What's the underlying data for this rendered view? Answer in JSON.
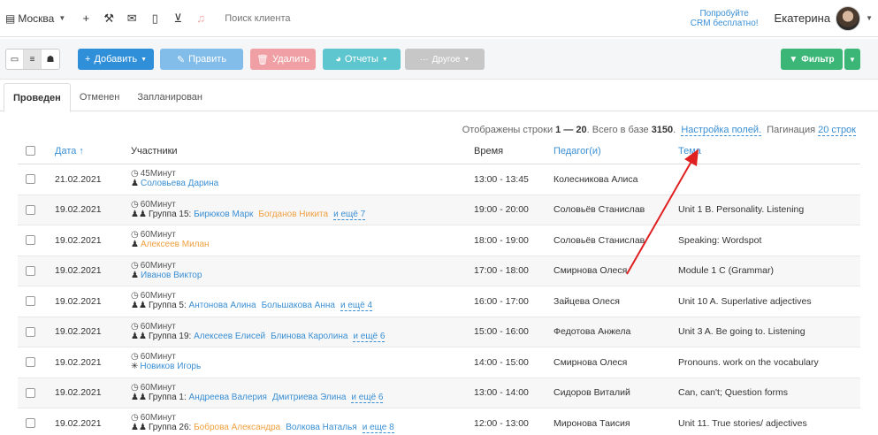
{
  "topbar": {
    "city": "Москва",
    "search_placeholder": "Поиск клиента",
    "promo_line1": "Попробуйте",
    "promo_line2": "CRM бесплатно!",
    "user_name": "Екатерина"
  },
  "toolbar": {
    "add": "Добавить",
    "edit": "Править",
    "delete": "Удалить",
    "reports": "Отчеты",
    "other": "Другое",
    "filter": "Фильтр"
  },
  "tabs": [
    "Проведен",
    "Отменен",
    "Запланирован"
  ],
  "info": {
    "prefix": "Отображены строки ",
    "range": "1 — 20",
    "mid": ". Всего в базе ",
    "total": "3150",
    "dot": ".",
    "fields_link": "Настройка полей.",
    "pagination_label": "Пагинация",
    "pagination_link": "20 строк"
  },
  "table": {
    "headers": {
      "date": "Дата",
      "date_sort": "↑",
      "participants": "Участники",
      "time": "Время",
      "teacher": "Педагог(и)",
      "topic": "Тема"
    },
    "rows": [
      {
        "date": "21.02.2021",
        "dur": "45Минут",
        "group": "",
        "s1": "Соловьева Дарина",
        "s1c": "blue",
        "s2": "",
        "s2c": "",
        "more": "",
        "time": "13:00 - 13:45",
        "teacher": "Колесникова Алиса",
        "topic": ""
      },
      {
        "date": "19.02.2021",
        "dur": "60Минут",
        "group": "Группа 15:",
        "s1": "Бирюков Марк",
        "s1c": "blue",
        "s2": "Богданов Никита",
        "s2c": "orange",
        "more": "и ещё 7",
        "time": "19:00 - 20:00",
        "teacher": "Соловьёв Станислав",
        "topic": "Unit 1 B. Personality. Listening"
      },
      {
        "date": "19.02.2021",
        "dur": "60Минут",
        "group": "",
        "s1": "Алексеев Милан",
        "s1c": "orange",
        "s2": "",
        "s2c": "",
        "more": "",
        "time": "18:00 - 19:00",
        "teacher": "Соловьёв Станислав",
        "topic": "Speaking: Wordspot"
      },
      {
        "date": "19.02.2021",
        "dur": "60Минут",
        "group": "",
        "s1": "Иванов Виктор",
        "s1c": "blue",
        "s2": "",
        "s2c": "",
        "more": "",
        "time": "17:00 - 18:00",
        "teacher": "Смирнова Олеся",
        "topic": "Module 1 C (Grammar)"
      },
      {
        "date": "19.02.2021",
        "dur": "60Минут",
        "group": "Группа 5:",
        "s1": "Антонова Алина",
        "s1c": "blue",
        "s2": "Большакова Анна",
        "s2c": "blue",
        "more": "и ещё 4",
        "time": "16:00 - 17:00",
        "teacher": "Зайцева Олеся",
        "topic": "Unit 10 A. Superlative adjectives"
      },
      {
        "date": "19.02.2021",
        "dur": "60Минут",
        "group": "Группа 19:",
        "s1": "Алексеев Елисей",
        "s1c": "blue",
        "s2": "Блинова Каролина",
        "s2c": "blue",
        "more": "и ещё 6",
        "time": "15:00 - 16:00",
        "teacher": "Федотова Анжела",
        "topic": "Unit 3 A. Be going to. Listening"
      },
      {
        "date": "19.02.2021",
        "dur": "60Минут",
        "group": "",
        "s1": "Новиков Игорь",
        "s1c": "blue",
        "s2": "",
        "s2c": "",
        "more": "",
        "time": "14:00 - 15:00",
        "teacher": "Смирнова Олеся",
        "topic": "Pronouns. work on the vocabulary"
      },
      {
        "date": "19.02.2021",
        "dur": "60Минут",
        "group": "Группа 1:",
        "s1": "Андреева Валерия",
        "s1c": "blue",
        "s2": "Дмитриева Элина",
        "s2c": "blue",
        "more": "и ещё 6",
        "time": "13:00 - 14:00",
        "teacher": "Сидоров Виталий",
        "topic": "Can, can't; Question forms"
      },
      {
        "date": "19.02.2021",
        "dur": "60Минут",
        "group": "Группа 26:",
        "s1": "Боброва Александра",
        "s1c": "orange",
        "s2": "Волкова Наталья",
        "s2c": "blue",
        "more": "и еще 8",
        "time": "12:00 - 13:00",
        "teacher": "Миронова Таисия",
        "topic": "Unit 11. True stories/ adjectives"
      }
    ]
  },
  "colors": {
    "link": "#3a8fd4",
    "arrow": "#e02020",
    "add": "#2f8fd8",
    "filter": "#3bb676"
  }
}
